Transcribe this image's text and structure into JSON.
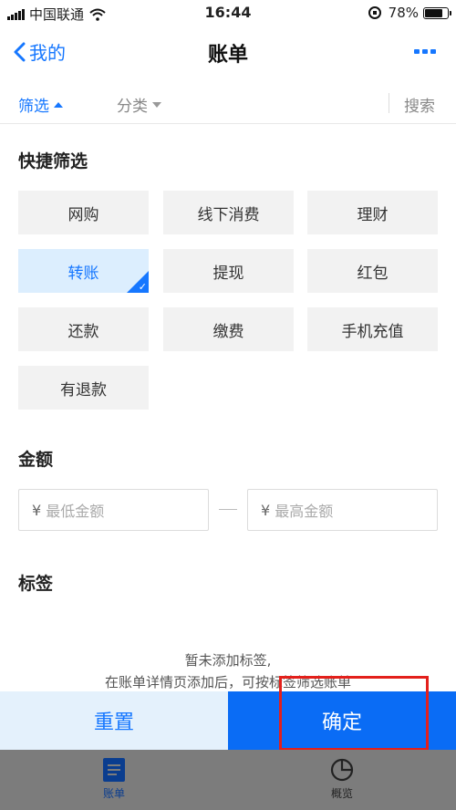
{
  "status_bar": {
    "carrier": "中国联通",
    "time": "16:44",
    "battery": "78%",
    "battery_level": 0.78
  },
  "nav": {
    "back_label": "我的",
    "title": "账单",
    "more_icon": "more-dots-icon"
  },
  "filter_bar": {
    "filter_label": "筛选",
    "category_label": "分类",
    "search_label": "搜索"
  },
  "quick_filter": {
    "title": "快捷筛选",
    "chips": [
      {
        "label": "网购",
        "selected": false
      },
      {
        "label": "线下消费",
        "selected": false
      },
      {
        "label": "理财",
        "selected": false
      },
      {
        "label": "转账",
        "selected": true
      },
      {
        "label": "提现",
        "selected": false
      },
      {
        "label": "红包",
        "selected": false
      },
      {
        "label": "还款",
        "selected": false
      },
      {
        "label": "缴费",
        "selected": false
      },
      {
        "label": "手机充值",
        "selected": false
      },
      {
        "label": "有退款",
        "selected": false
      }
    ]
  },
  "amount": {
    "title": "金额",
    "currency_symbol": "¥",
    "min_placeholder": "最低金额",
    "max_placeholder": "最高金额"
  },
  "tags": {
    "title": "标签",
    "empty_line1": "暂未添加标签,",
    "empty_line2": "在账单详情页添加后，可按标签筛选账单"
  },
  "actions": {
    "reset_label": "重置",
    "confirm_label": "确定"
  },
  "tab_bar": {
    "tabs": [
      {
        "label": "账单",
        "icon": "bill-icon",
        "active": true
      },
      {
        "label": "概览",
        "icon": "pie-chart-icon",
        "active": false
      }
    ]
  },
  "colors": {
    "accent": "#1677ff",
    "confirm_bg": "#0a6cf5",
    "reset_bg": "#e4f1fc",
    "chip_bg": "#f2f2f2",
    "chip_selected_bg": "#dceefe",
    "highlight_box": "#e3201b",
    "tabbar_bg": "#7c7c7c"
  }
}
